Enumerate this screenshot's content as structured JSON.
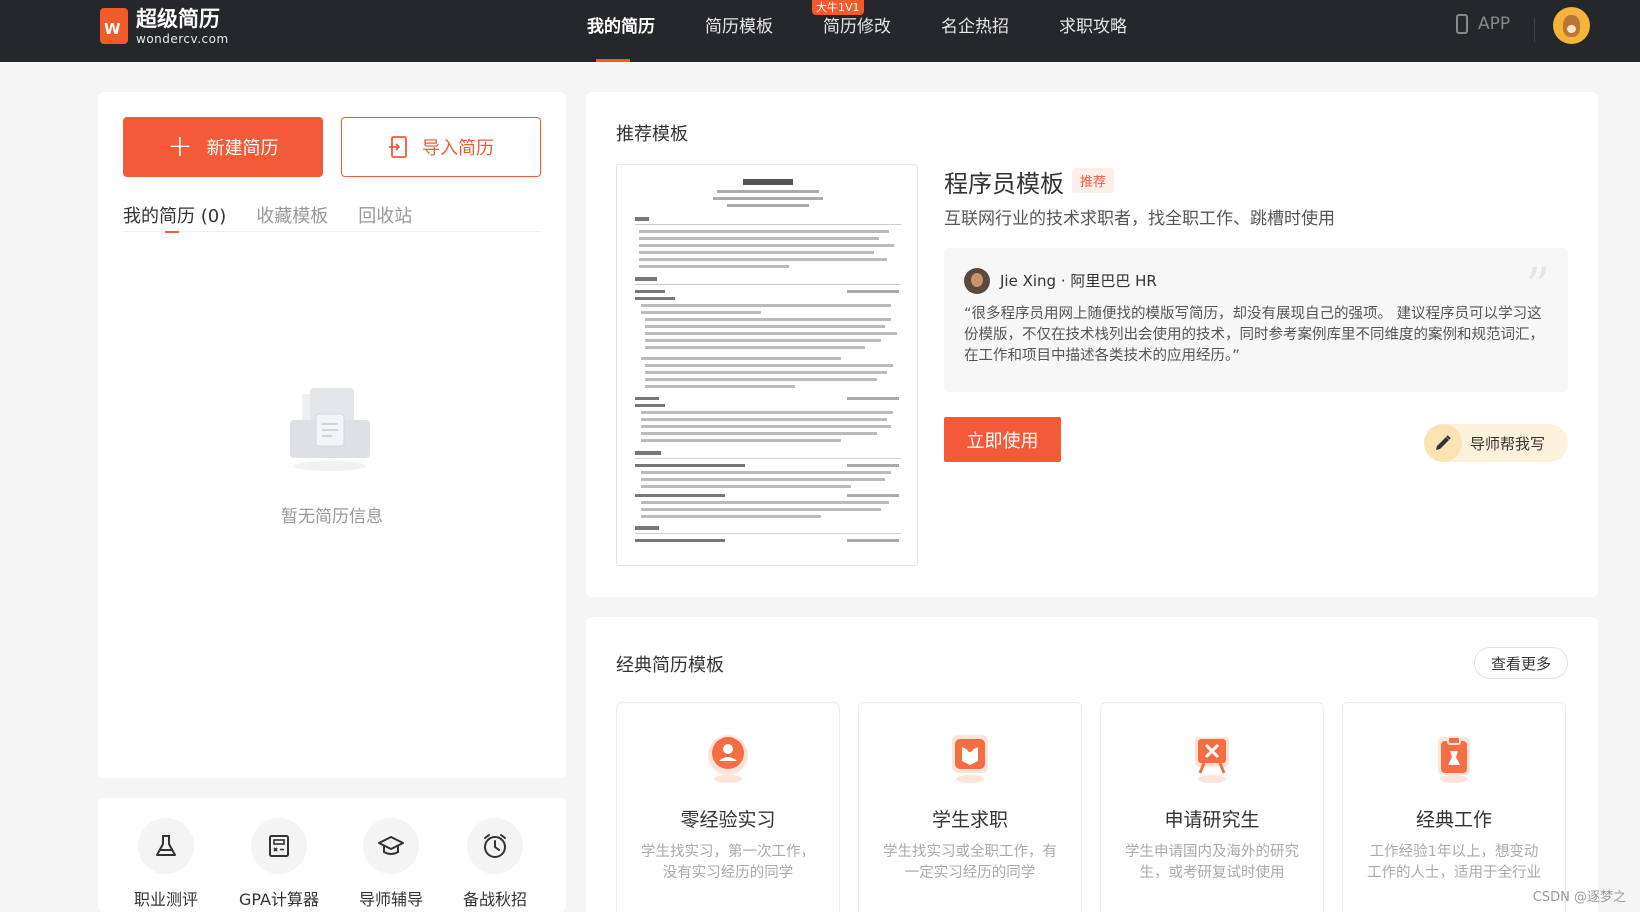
{
  "header": {
    "logo_cn": "超级简历",
    "logo_en": "wondercv.com",
    "logo_mark": "W",
    "nav": [
      {
        "label": "我的简历",
        "active": true
      },
      {
        "label": "简历模板",
        "active": false
      },
      {
        "label": "简历修改",
        "active": false
      },
      {
        "label": "名企热招",
        "active": false
      },
      {
        "label": "求职攻略",
        "active": false
      }
    ],
    "nav_badge": "大牛1V1",
    "app_label": "APP"
  },
  "left": {
    "new_resume_label": "新建简历",
    "import_resume_label": "导入简历",
    "tabs": [
      "我的简历 (0)",
      "收藏模板",
      "回收站"
    ],
    "empty_text": "暂无简历信息"
  },
  "tools": [
    {
      "label": "职业测评",
      "icon": "flask-icon"
    },
    {
      "label": "GPA计算器",
      "icon": "calculator-icon"
    },
    {
      "label": "导师辅导",
      "icon": "graduation-cap-icon"
    },
    {
      "label": "备战秋招",
      "icon": "alarm-clock-icon"
    }
  ],
  "recommend": {
    "section_title": "推荐模板",
    "template_title": "程序员模板",
    "badge": "推荐",
    "description": "互联网行业的技术求职者，找全职工作、跳槽时使用",
    "hr_name": "Jie Xing · 阿里巴巴 HR",
    "quote": "“很多程序员用网上随便找的模版写简历，却没有展现自己的强项。 建议程序员可以学习这份模版，不仅在技术栈列出会使用的技术，同时参考案例库里不同维度的案例和规范词汇，在工作和项目中描述各类技术的应用经历。”",
    "use_button": "立即使用",
    "mentor_button": "导师帮我写"
  },
  "classic": {
    "section_title": "经典简历模板",
    "more_button": "查看更多",
    "categories": [
      {
        "name": "零经验实习",
        "desc": "学生找实习，第一次工作，没有实习经历的同学",
        "icon": "person-icon"
      },
      {
        "name": "学生求职",
        "desc": "学生找实习或全职工作，有一定实习经历的同学",
        "icon": "book-icon"
      },
      {
        "name": "申请研究生",
        "desc": "学生申请国内及海外的研究生，或考研复试时使用",
        "icon": "easel-icon"
      },
      {
        "name": "经典工作",
        "desc": "工作经验1年以上，想变动工作的人士，适用于全行业",
        "icon": "clipboard-icon"
      }
    ]
  },
  "watermark": "CSDN @逐梦之"
}
